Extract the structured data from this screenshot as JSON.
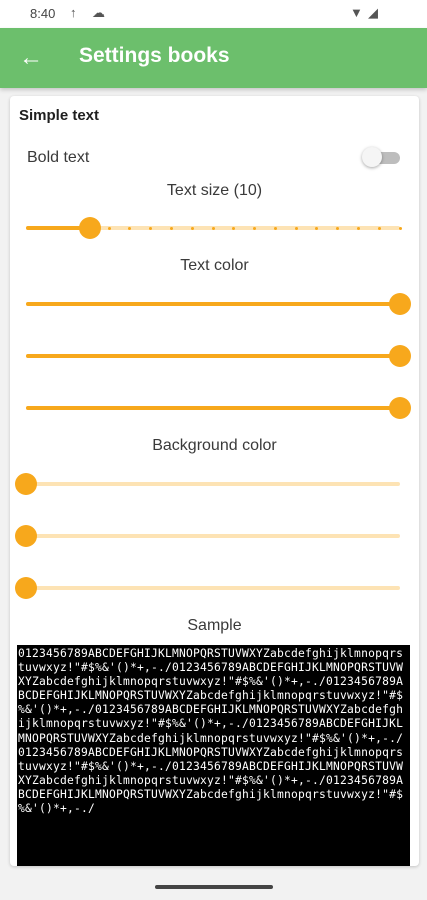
{
  "status": {
    "time": "8:40",
    "upload_icon": "upload-arrow-icon",
    "cloud_icon": "cloud-icon",
    "wifi_icon": "wifi-icon",
    "signal_icon": "signal-icon"
  },
  "appbar": {
    "title": "Settings books",
    "back_icon": "arrow-back-icon"
  },
  "card": {
    "section_title": "Simple text",
    "bold_label": "Bold text",
    "bold_enabled": false,
    "text_size_label": "Text size (10)",
    "text_size_level": 0.17,
    "text_size_steps": 18,
    "text_color_label": "Text color",
    "text_color_channels": [
      1.0,
      1.0,
      1.0
    ],
    "background_color_label": "Background color",
    "background_color_channels": [
      0.0,
      0.0,
      0.0
    ],
    "sample_label": "Sample",
    "sample_text": "0123456789ABCDEFGHIJKLMNOPQRSTUVWXYZabcdefghijklmnopqrstuvwxyz!\"#$%&'()*+,-./0123456789ABCDEFGHIJKLMNOPQRSTUVWXYZabcdefghijklmnopqrstuvwxyz!\"#$%&'()*+,-./0123456789ABCDEFGHIJKLMNOPQRSTUVWXYZabcdefghijklmnopqrstuvwxyz!\"#$%&'()*+,-./0123456789ABCDEFGHIJKLMNOPQRSTUVWXYZabcdefghijklmnopqrstuvwxyz!\"#$%&'()*+,-./0123456789ABCDEFGHIJKLMNOPQRSTUVWXYZabcdefghijklmnopqrstuvwxyz!\"#$%&'()*+,-./0123456789ABCDEFGHIJKLMNOPQRSTUVWXYZabcdefghijklmnopqrstuvwxyz!\"#$%&'()*+,-./0123456789ABCDEFGHIJKLMNOPQRSTUVWXYZabcdefghijklmnopqrstuvwxyz!\"#$%&'()*+,-./0123456789ABCDEFGHIJKLMNOPQRSTUVWXYZabcdefghijklmnopqrstuvwxyz!\"#$%&'()*+,-./"
  },
  "colors": {
    "appbar": "#6cbf6c",
    "accent": "#f7a81c",
    "accent_light": "#fde3b4"
  }
}
